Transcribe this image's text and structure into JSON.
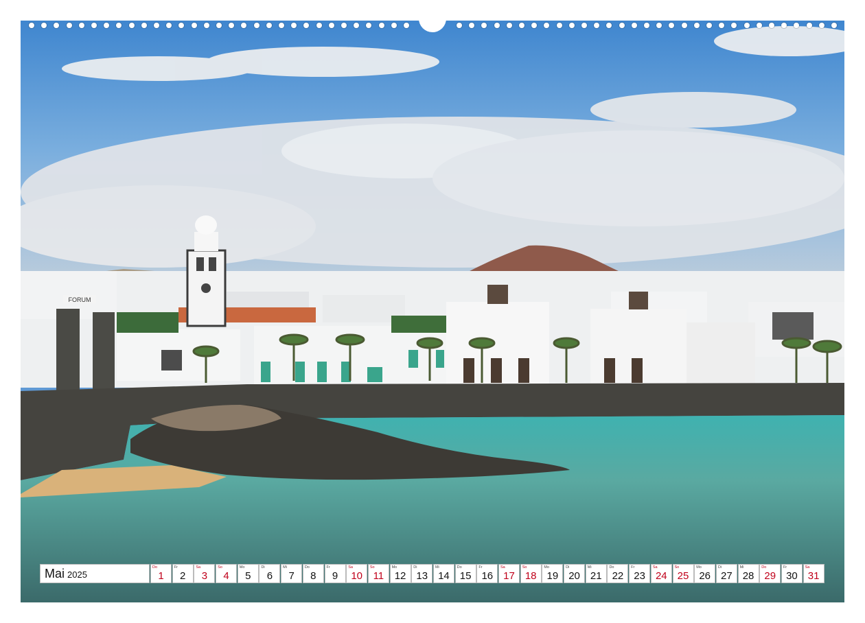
{
  "calendar": {
    "month": "Mai",
    "year": "2025",
    "days": [
      {
        "wd": "Do",
        "d": "1",
        "holiday": true
      },
      {
        "wd": "Fr",
        "d": "2",
        "holiday": false
      },
      {
        "wd": "Sa",
        "d": "3",
        "holiday": true
      },
      {
        "wd": "So",
        "d": "4",
        "holiday": true
      },
      {
        "wd": "Mo",
        "d": "5",
        "holiday": false
      },
      {
        "wd": "Di",
        "d": "6",
        "holiday": false
      },
      {
        "wd": "Mi",
        "d": "7",
        "holiday": false
      },
      {
        "wd": "Do",
        "d": "8",
        "holiday": false
      },
      {
        "wd": "Fr",
        "d": "9",
        "holiday": false
      },
      {
        "wd": "Sa",
        "d": "10",
        "holiday": true
      },
      {
        "wd": "So",
        "d": "11",
        "holiday": true
      },
      {
        "wd": "Mo",
        "d": "12",
        "holiday": false
      },
      {
        "wd": "Di",
        "d": "13",
        "holiday": false
      },
      {
        "wd": "Mi",
        "d": "14",
        "holiday": false
      },
      {
        "wd": "Do",
        "d": "15",
        "holiday": false
      },
      {
        "wd": "Fr",
        "d": "16",
        "holiday": false
      },
      {
        "wd": "Sa",
        "d": "17",
        "holiday": true
      },
      {
        "wd": "So",
        "d": "18",
        "holiday": true
      },
      {
        "wd": "Mo",
        "d": "19",
        "holiday": false
      },
      {
        "wd": "Di",
        "d": "20",
        "holiday": false
      },
      {
        "wd": "Mi",
        "d": "21",
        "holiday": false
      },
      {
        "wd": "Do",
        "d": "22",
        "holiday": false
      },
      {
        "wd": "Fr",
        "d": "23",
        "holiday": false
      },
      {
        "wd": "Sa",
        "d": "24",
        "holiday": true
      },
      {
        "wd": "So",
        "d": "25",
        "holiday": true
      },
      {
        "wd": "Mo",
        "d": "26",
        "holiday": false
      },
      {
        "wd": "Di",
        "d": "27",
        "holiday": false
      },
      {
        "wd": "Mi",
        "d": "28",
        "holiday": false
      },
      {
        "wd": "Do",
        "d": "29",
        "holiday": true
      },
      {
        "wd": "Fr",
        "d": "30",
        "holiday": false
      },
      {
        "wd": "Sa",
        "d": "31",
        "holiday": true
      }
    ]
  },
  "photo": {
    "sign_text": "FORUM"
  },
  "colors": {
    "sky": "#5f99d4",
    "sea": "#5fb3ad",
    "holiday_red": "#c0001a"
  }
}
